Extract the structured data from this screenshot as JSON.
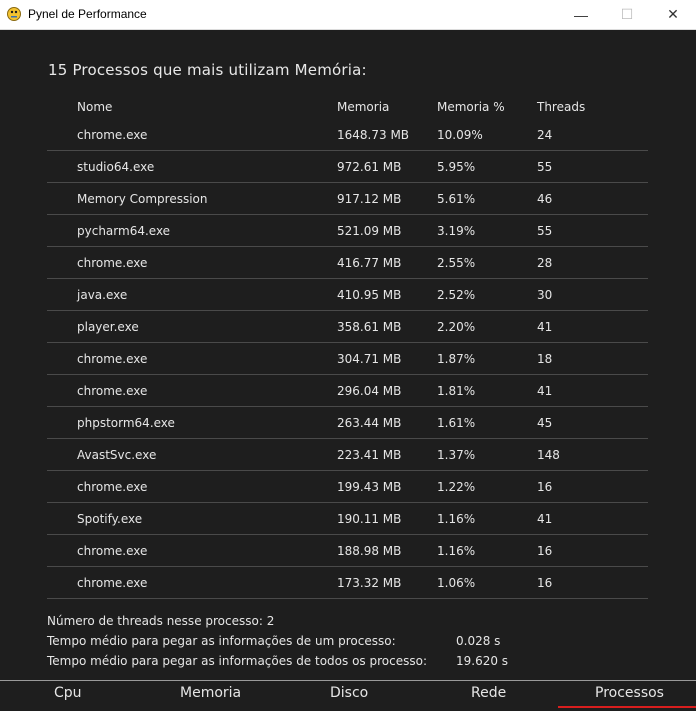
{
  "window": {
    "title": "Pynel de Performance",
    "minimize_glyph": "—",
    "maximize_glyph": "☐",
    "close_glyph": "✕",
    "icon": "pygame-snake-icon"
  },
  "main": {
    "heading": "15 Processos que mais utilizam Memória:",
    "columns": [
      "Nome",
      "Memoria",
      "Memoria %",
      "Threads"
    ],
    "rows": [
      {
        "name": "chrome.exe",
        "memory": "1648.73 MB",
        "percent": "10.09%",
        "threads": "24"
      },
      {
        "name": "studio64.exe",
        "memory": "972.61 MB",
        "percent": "5.95%",
        "threads": "55"
      },
      {
        "name": "Memory Compression",
        "memory": "917.12 MB",
        "percent": "5.61%",
        "threads": "46"
      },
      {
        "name": "pycharm64.exe",
        "memory": "521.09 MB",
        "percent": "3.19%",
        "threads": "55"
      },
      {
        "name": "chrome.exe",
        "memory": "416.77 MB",
        "percent": "2.55%",
        "threads": "28"
      },
      {
        "name": "java.exe",
        "memory": "410.95 MB",
        "percent": "2.52%",
        "threads": "30"
      },
      {
        "name": "player.exe",
        "memory": "358.61 MB",
        "percent": "2.20%",
        "threads": "41"
      },
      {
        "name": "chrome.exe",
        "memory": "304.71 MB",
        "percent": "1.87%",
        "threads": "18"
      },
      {
        "name": "chrome.exe",
        "memory": "296.04 MB",
        "percent": "1.81%",
        "threads": "41"
      },
      {
        "name": "phpstorm64.exe",
        "memory": "263.44 MB",
        "percent": "1.61%",
        "threads": "45"
      },
      {
        "name": "AvastSvc.exe",
        "memory": "223.41 MB",
        "percent": "1.37%",
        "threads": "148"
      },
      {
        "name": "chrome.exe",
        "memory": "199.43 MB",
        "percent": "1.22%",
        "threads": "16"
      },
      {
        "name": "Spotify.exe",
        "memory": "190.11 MB",
        "percent": "1.16%",
        "threads": "41"
      },
      {
        "name": "chrome.exe",
        "memory": "188.98 MB",
        "percent": "1.16%",
        "threads": "16"
      },
      {
        "name": "chrome.exe",
        "memory": "173.32 MB",
        "percent": "1.06%",
        "threads": "16"
      }
    ]
  },
  "info": {
    "threads_label": "Número de threads nesse processo: 2",
    "avg_one_label": "Tempo médio para pegar as informações de um processo:",
    "avg_one_value": "0.028 s",
    "avg_all_label": "Tempo médio para pegar as informações de todos os processo:",
    "avg_all_value": "19.620 s"
  },
  "tabs": {
    "items": [
      "Cpu",
      "Memoria",
      "Disco",
      "Rede",
      "Processos"
    ],
    "active": "Processos",
    "active_color": "#d81e1e"
  }
}
